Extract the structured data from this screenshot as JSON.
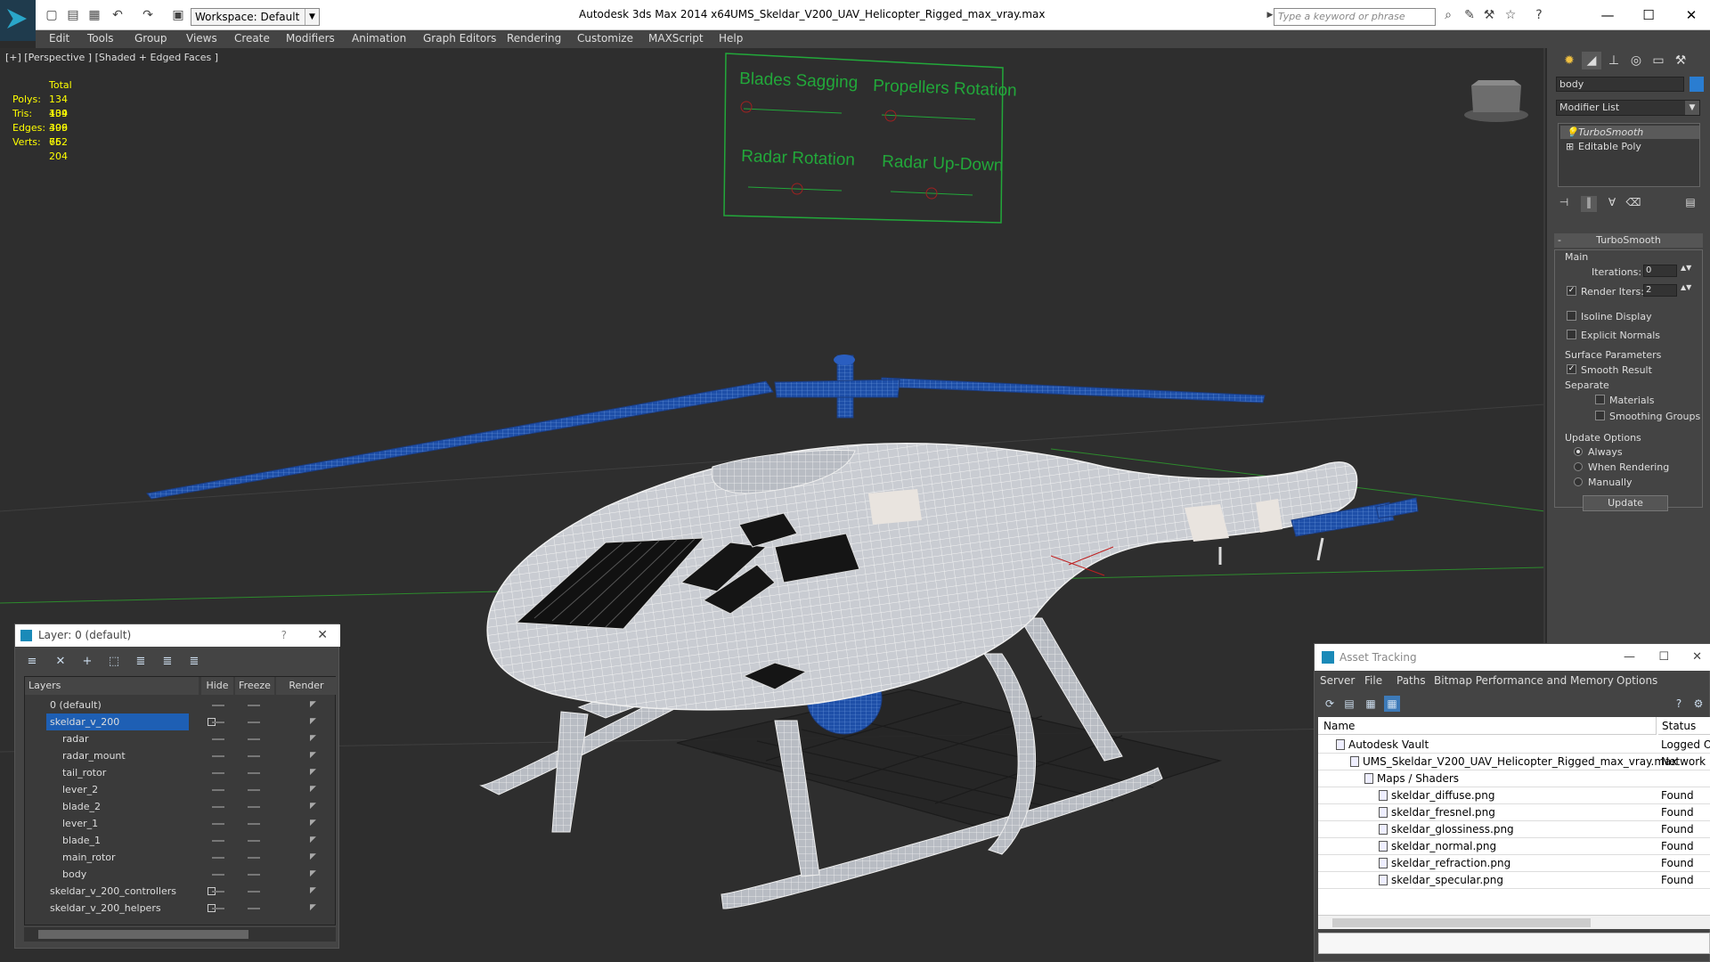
{
  "window": {
    "app_title": "Autodesk 3ds Max  2014 x64",
    "file_title": "UMS_Skeldar_V200_UAV_Helicopter_Rigged_max_vray.max",
    "workspace": "Workspace: Default",
    "search_placeholder": "Type a keyword or phrase"
  },
  "menu": [
    "Edit",
    "Tools",
    "Group",
    "Views",
    "Create",
    "Modifiers",
    "Animation",
    "Graph Editors",
    "Rendering",
    "Customize",
    "MAXScript",
    "Help"
  ],
  "viewport": {
    "label": "[+] [Perspective ] [Shaded + Edged Faces ]",
    "stats": {
      "total_label": "Total",
      "polys_label": "Polys:",
      "polys": "134 409",
      "tris_label": "Tris:",
      "tris": "134 409",
      "edges_label": "Edges:",
      "edges": "396 662",
      "verts_label": "Verts:",
      "verts": "75 204"
    },
    "controls": {
      "blades": "Blades Sagging",
      "propellers": "Propellers Rotation",
      "radar_rot": "Radar Rotation",
      "radar_ud": "Radar Up-Down"
    },
    "colors": {
      "wire": "#e8e8e8",
      "blue": "#1e4fa8",
      "controls": "#22a83a"
    }
  },
  "command_panel": {
    "object_name": "body",
    "modifier_list": "Modifier List",
    "stack": [
      "TurboSmooth",
      "Editable Poly"
    ],
    "rollout_title": "TurboSmooth",
    "main_label": "Main",
    "iterations_label": "Iterations:",
    "iterations": "0",
    "render_iters_label": "Render Iters:",
    "render_iters": "2",
    "isoline": "Isoline Display",
    "explicit": "Explicit Normals",
    "surface_label": "Surface Parameters",
    "smooth_result": "Smooth Result",
    "separate_label": "Separate",
    "materials": "Materials",
    "smoothing_groups": "Smoothing Groups",
    "update_label": "Update Options",
    "always": "Always",
    "when_rendering": "When Rendering",
    "manually": "Manually",
    "update_button": "Update"
  },
  "layers": {
    "title": "Layer: 0 (default)",
    "help": "?",
    "col_layers": "Layers",
    "col_hide": "Hide",
    "col_freeze": "Freeze",
    "col_render": "Render",
    "rows": [
      {
        "name": "0 (default)",
        "indent": 0
      },
      {
        "name": "skeldar_v_200",
        "indent": 0
      },
      {
        "name": "radar",
        "indent": 1
      },
      {
        "name": "radar_mount",
        "indent": 1
      },
      {
        "name": "tail_rotor",
        "indent": 1
      },
      {
        "name": "lever_2",
        "indent": 1
      },
      {
        "name": "blade_2",
        "indent": 1
      },
      {
        "name": "lever_1",
        "indent": 1
      },
      {
        "name": "blade_1",
        "indent": 1
      },
      {
        "name": "main_rotor",
        "indent": 1
      },
      {
        "name": "body",
        "indent": 1
      },
      {
        "name": "skeldar_v_200_controllers",
        "indent": 0
      },
      {
        "name": "skeldar_v_200_helpers",
        "indent": 0
      }
    ]
  },
  "assets": {
    "title": "Asset Tracking",
    "menu": [
      "Server",
      "File",
      "Paths",
      "Bitmap Performance and Memory",
      "Options"
    ],
    "col_name": "Name",
    "col_status": "Status",
    "rows": [
      {
        "name": "Autodesk Vault",
        "status": "Logged Ou",
        "indent": 0
      },
      {
        "name": "UMS_Skeldar_V200_UAV_Helicopter_Rigged_max_vray.max",
        "status": "Network P",
        "indent": 1
      },
      {
        "name": "Maps / Shaders",
        "status": "",
        "indent": 2
      },
      {
        "name": "skeldar_diffuse.png",
        "status": "Found",
        "indent": 3
      },
      {
        "name": "skeldar_fresnel.png",
        "status": "Found",
        "indent": 3
      },
      {
        "name": "skeldar_glossiness.png",
        "status": "Found",
        "indent": 3
      },
      {
        "name": "skeldar_normal.png",
        "status": "Found",
        "indent": 3
      },
      {
        "name": "skeldar_refraction.png",
        "status": "Found",
        "indent": 3
      },
      {
        "name": "skeldar_specular.png",
        "status": "Found",
        "indent": 3
      }
    ]
  }
}
